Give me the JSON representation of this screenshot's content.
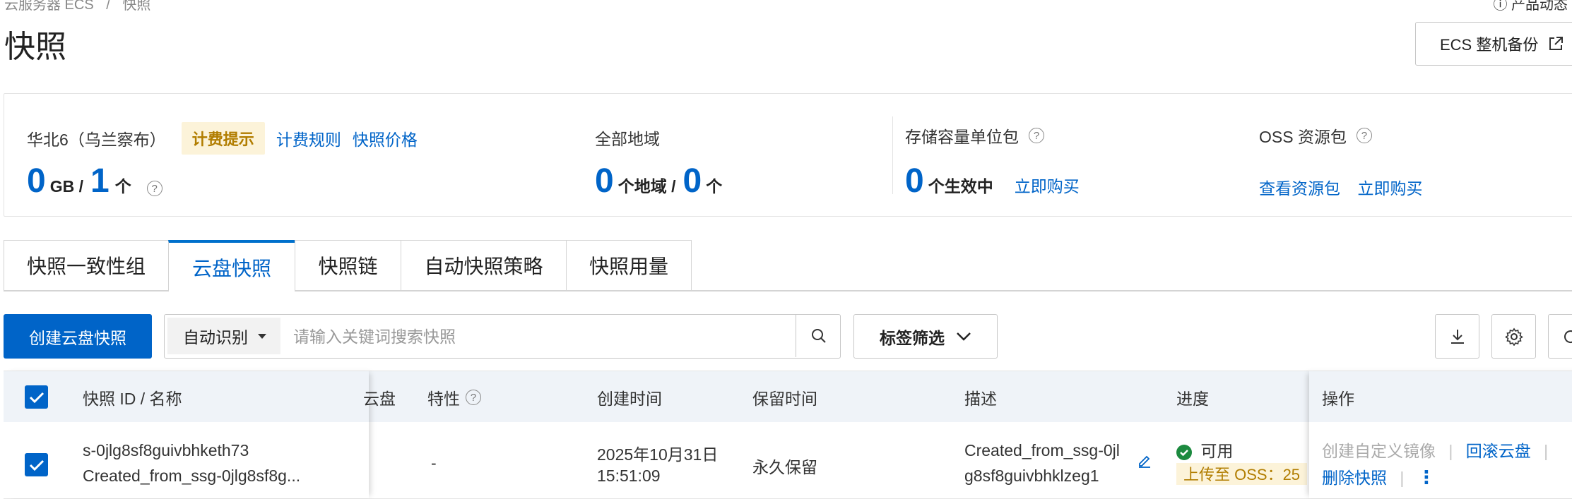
{
  "breadcrumb": {
    "parent": "云服务器 ECS",
    "sep": "/",
    "current": "快照"
  },
  "top_right_link": "产品动态",
  "page_title": "快照",
  "ecs_backup_button": "ECS 整机备份",
  "summary": {
    "region": "华北6（乌兰察布）",
    "billing_tag": "计费提示",
    "billing_rules": "计费规则",
    "snapshot_price": "快照价格",
    "used_gb": "0",
    "gb_unit": "GB /",
    "count": "1",
    "count_unit": "个",
    "all_regions_label": "全部地域",
    "regions_num": "0",
    "regions_unit": "个地域 /",
    "regions_total": "0",
    "regions_total_unit": "个",
    "storage_pkg_label": "存储容量单位包",
    "storage_pkg_num": "0",
    "storage_pkg_unit": "个生效中",
    "buy_now_1": "立即购买",
    "oss_pkg_label": "OSS 资源包",
    "view_pkg": "查看资源包",
    "buy_now_2": "立即购买"
  },
  "tabs": [
    {
      "label": "快照一致性组"
    },
    {
      "label": "云盘快照"
    },
    {
      "label": "快照链"
    },
    {
      "label": "自动快照策略"
    },
    {
      "label": "快照用量"
    }
  ],
  "toolbar": {
    "create_button": "创建云盘快照",
    "search_select": "自动识别",
    "search_placeholder": "请输入关键词搜索快照",
    "tag_filter": "标签筛选"
  },
  "table": {
    "headers": {
      "id_name": "快照 ID / 名称",
      "disk": "云盘",
      "feature": "特性",
      "created": "创建时间",
      "retention": "保留时间",
      "desc": "描述",
      "progress": "进度",
      "actions": "操作"
    },
    "rows": [
      {
        "id": "s-0jlg8sf8guivbhketh73",
        "name": "Created_from_ssg-0jlg8sf8g...",
        "feature": "-",
        "created_date": "2025年10月31日",
        "created_time": "15:51:09",
        "retention": "永久保留",
        "desc_line1": "Created_from_ssg-0jl",
        "desc_line2": "g8sf8guivbhklzeg1",
        "status": "可用",
        "oss_tag": "上传至 OSS：25",
        "action_create_image": "创建自定义镜像",
        "action_rollback": "回滚云盘",
        "action_delete": "删除快照"
      }
    ]
  },
  "colors": {
    "primary": "#0064c8",
    "warning_bg": "#fcf3d9",
    "warning_text": "#b17d00",
    "success": "#1c8a3f"
  }
}
